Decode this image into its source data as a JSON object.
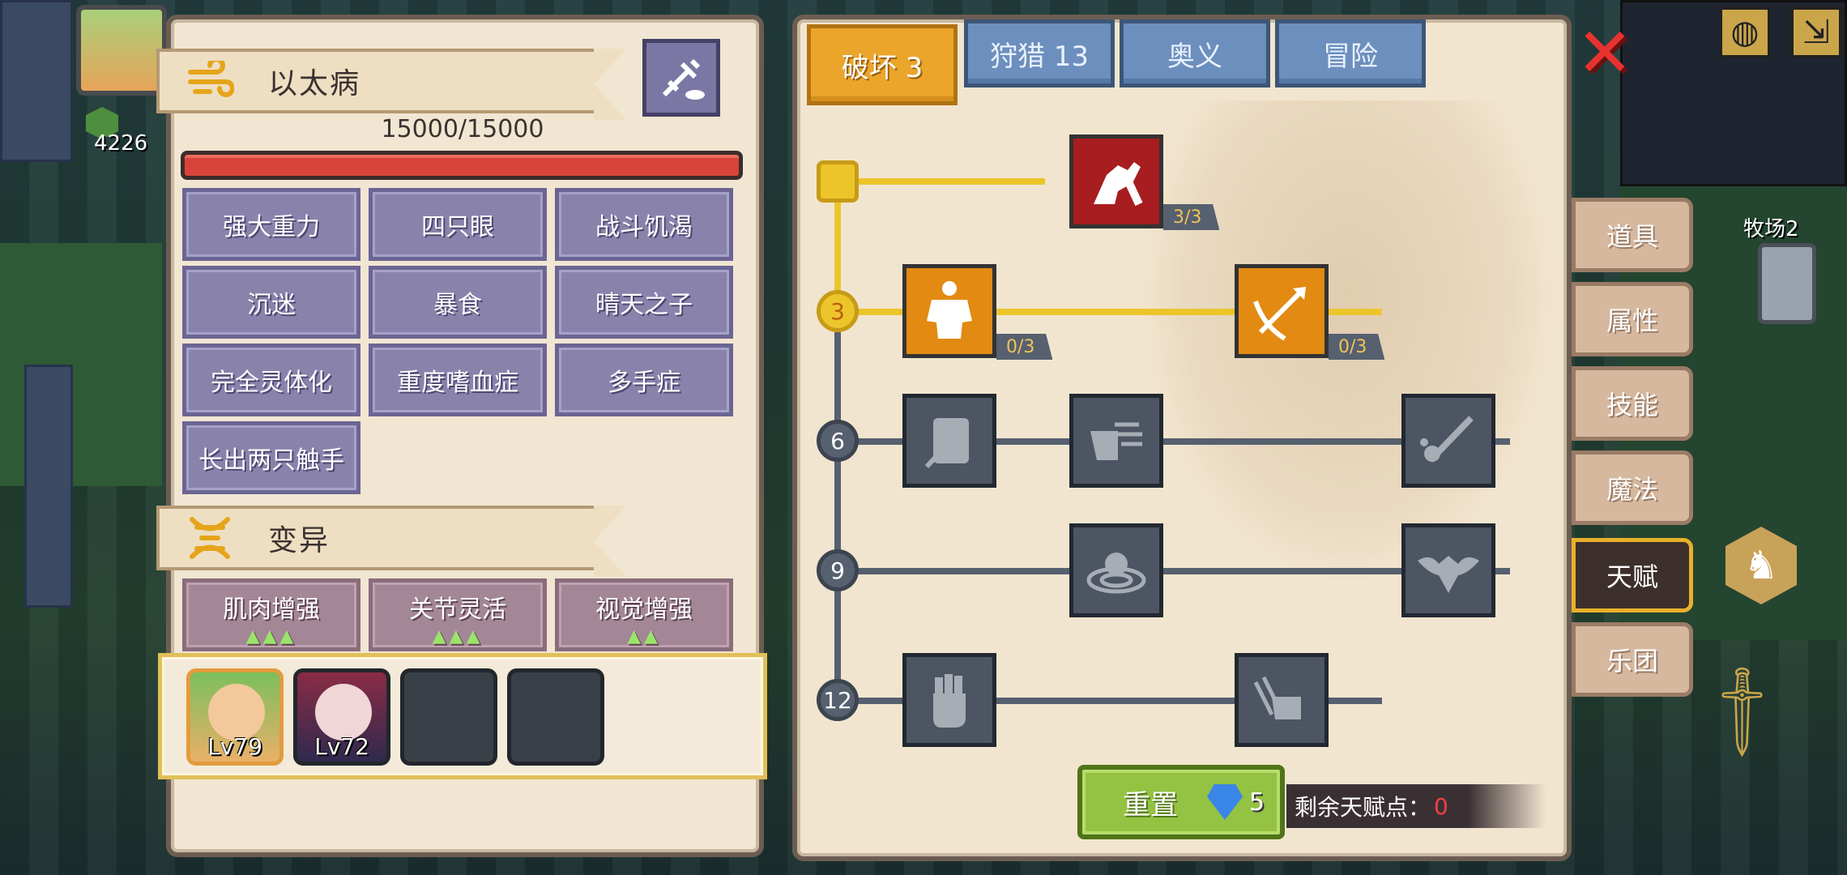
{
  "hud": {
    "gem_count": "4226",
    "farm_label": "牧场2"
  },
  "disease_section": {
    "title": "以太病",
    "hp_text": "15000/15000",
    "traits": [
      "强大重力",
      "四只眼",
      "战斗饥渴",
      "沉迷",
      "暴食",
      "晴天之子",
      "完全灵体化",
      "重度嗜血症",
      "多手症",
      "长出两只触手"
    ]
  },
  "mutation_section": {
    "title": "变异",
    "items": [
      {
        "label": "肌肉增强",
        "level": 3
      },
      {
        "label": "关节灵活",
        "level": 3
      },
      {
        "label": "视觉增强",
        "level": 2
      }
    ]
  },
  "party": {
    "members": [
      {
        "level": "Lv79"
      },
      {
        "level": "Lv72"
      }
    ]
  },
  "talent": {
    "tabs": [
      {
        "label": "破坏 3",
        "active": true
      },
      {
        "label": "狩猎 13",
        "active": false
      },
      {
        "label": "奥义",
        "active": false
      },
      {
        "label": "冒险",
        "active": false
      }
    ],
    "tiers": [
      "3",
      "6",
      "9",
      "12"
    ],
    "skills": [
      {
        "name": "arm-wrestle-skill-icon",
        "count": "3/3"
      },
      {
        "name": "muscle-body-skill-icon",
        "count": "0/3"
      },
      {
        "name": "arrow-pierce-skill-icon",
        "count": "0/3"
      }
    ],
    "reset_label": "重置",
    "reset_cost": "5",
    "points_label": "剩余天赋点：",
    "points_value": "0"
  },
  "side_menu": [
    "道具",
    "属性",
    "技能",
    "魔法",
    "天赋",
    "乐团"
  ],
  "side_menu_active": "天赋",
  "colors": {
    "active_tab": "#eba52a",
    "tab": "#6c8fbd",
    "trait": "#8983ac",
    "hp": "#d8443a",
    "reset": "#94c243",
    "points_zero": "#f24040"
  }
}
